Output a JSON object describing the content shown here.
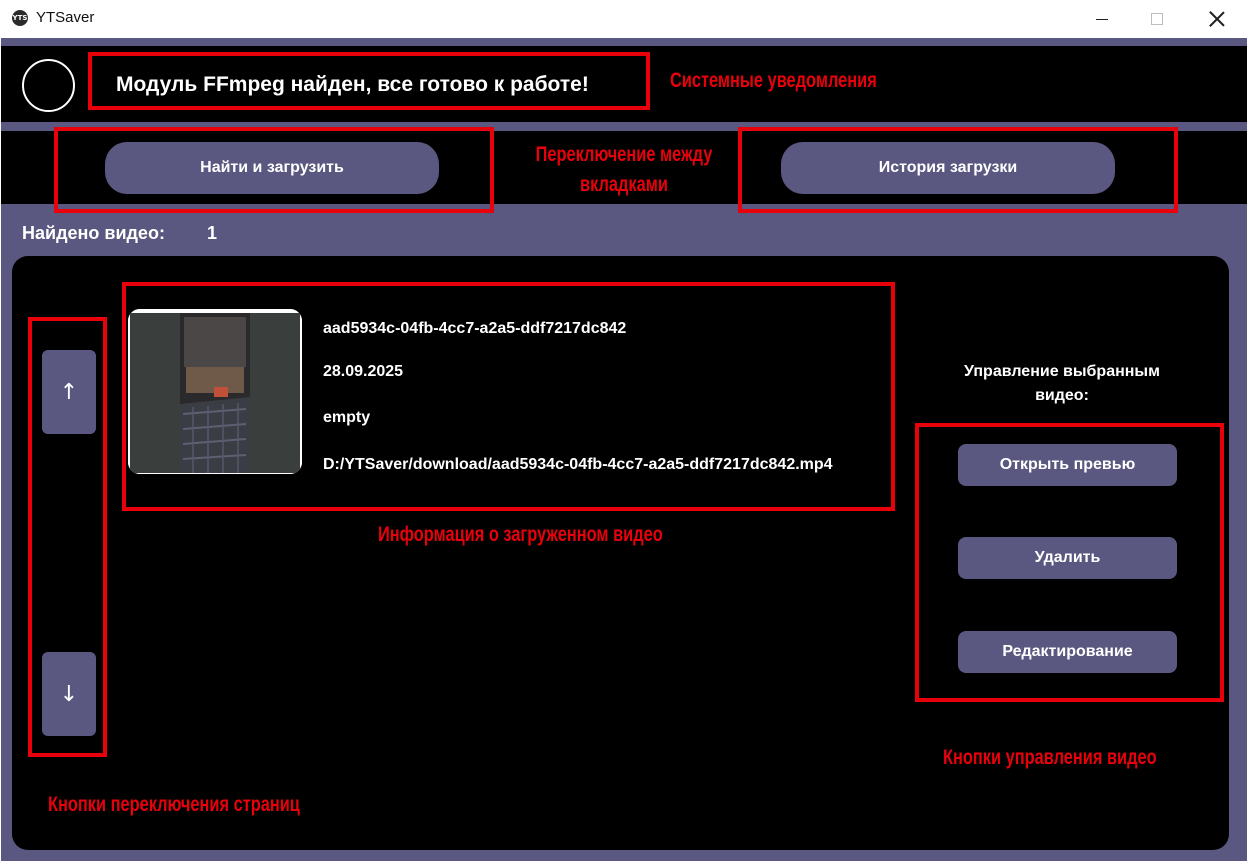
{
  "window": {
    "title": "YTSaver",
    "icon_text": "YTS"
  },
  "notification": {
    "text": "Модуль FFmpeg найден, все готово к работе!"
  },
  "tabs": {
    "search_label": "Найти и загрузить",
    "history_label": "История загрузки"
  },
  "found": {
    "label": "Найдено видео:",
    "count": "1"
  },
  "pager": {
    "up_label": "↑",
    "down_label": "↓"
  },
  "video": {
    "id": "aad5934c-04fb-4cc7-a2a5-ddf7217dc842",
    "date": "28.09.2025",
    "description": "empty",
    "path": "D:/YTSaver/download/aad5934c-04fb-4cc7-a2a5-ddf7217dc842.mp4"
  },
  "manage": {
    "title": "Управление выбранным видео:",
    "preview_label": "Открыть превью",
    "delete_label": "Удалить",
    "edit_label": "Редактирование"
  },
  "annotations": {
    "system_notifications": "Системные уведомления",
    "tab_switch_line1": "Переключение между",
    "tab_switch_line2": "вкладками",
    "video_info": "Информация о загруженном видео",
    "video_controls": "Кнопки управления видео",
    "page_buttons": "Кнопки переключения страниц"
  },
  "colors": {
    "accent": "#5a5880",
    "panel": "#000000",
    "annotation": "#e8000b"
  }
}
